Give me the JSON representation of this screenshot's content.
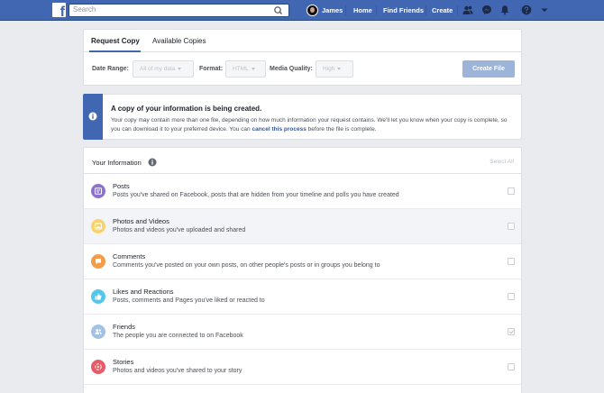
{
  "topbar": {
    "search_placeholder": "Search",
    "user_name": "James",
    "links": [
      "Home",
      "Find Friends",
      "Create"
    ],
    "icons": [
      "friend-requests-icon",
      "messenger-icon",
      "notifications-icon",
      "help-icon",
      "account-menu-icon"
    ]
  },
  "request": {
    "tabs": [
      "Request Copy",
      "Available Copies"
    ],
    "date_range_label": "Date Range:",
    "date_range_value": "All of my data",
    "format_label": "Format:",
    "format_value": "HTML",
    "quality_label": "Media Quality:",
    "quality_value": "High",
    "create_button": "Create File"
  },
  "notice": {
    "title": "A copy of your information is being created.",
    "body_prefix": "Your copy may contain more than one file, depending on how much information your request contains. We'll let you know when your copy is complete, so you can download it to your preferred device. You can ",
    "link": "cancel this process",
    "body_suffix": " before the file is complete."
  },
  "info": {
    "title": "Your Information",
    "select_all": "Select All",
    "rows": [
      {
        "title": "Posts",
        "desc": "Posts you've shared on Facebook, posts that are hidden from your timeline and polls you have created",
        "color": "#8c72cb",
        "icon": "posts-icon",
        "checked": false
      },
      {
        "title": "Photos and Videos",
        "desc": "Photos and videos you've uploaded and shared",
        "color": "#f7d46b",
        "icon": "photos-icon",
        "checked": false
      },
      {
        "title": "Comments",
        "desc": "Comments you've posted on your own posts, on other people's posts or in groups you belong to",
        "color": "#f39c4a",
        "icon": "comments-icon",
        "checked": false
      },
      {
        "title": "Likes and Reactions",
        "desc": "Posts, comments and Pages you've liked or reacted to",
        "color": "#54c7ec",
        "icon": "likes-icon",
        "checked": false
      },
      {
        "title": "Friends",
        "desc": "The people you are connected to on Facebook",
        "color": "#a3c2e3",
        "icon": "friends-icon",
        "checked": true
      },
      {
        "title": "Stories",
        "desc": "Photos and videos you've shared to your story",
        "color": "#e65b65",
        "icon": "stories-icon",
        "checked": false
      }
    ]
  }
}
